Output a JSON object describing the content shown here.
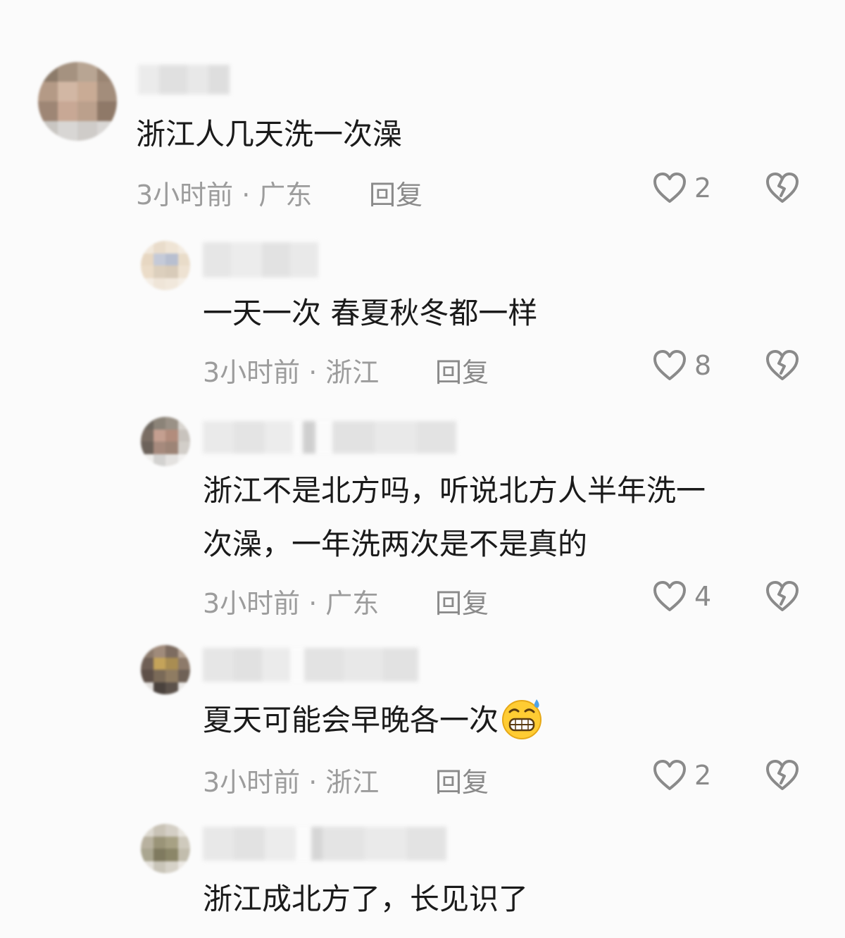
{
  "comments": [
    {
      "text": "浙江人几天洗一次澡",
      "time": "3小时前",
      "separator": "·",
      "location": "广东",
      "reply_label": "回复",
      "likes": "2"
    },
    {
      "text": "一天一次 春夏秋冬都一样",
      "time": "3小时前",
      "separator": "·",
      "location": "浙江",
      "reply_label": "回复",
      "likes": "8"
    },
    {
      "text_line1": "浙江不是北方吗，听说北方人半年洗一",
      "text_line2": "次澡，一年洗两次是不是真的",
      "time": "3小时前",
      "separator": "·",
      "location": "广东",
      "reply_label": "回复",
      "likes": "4"
    },
    {
      "text": "夏天可能会早晚各一次",
      "emoji": "grimacing-sweat-emoji",
      "time": "3小时前",
      "separator": "·",
      "location": "浙江",
      "reply_label": "回复",
      "likes": "2"
    },
    {
      "text": "浙江成北方了，长见识了"
    }
  ],
  "colors": {
    "text": "#1a1a1a",
    "meta": "#9c9c9c",
    "icon": "#8a8a8a",
    "background": "#fbfbfb"
  }
}
